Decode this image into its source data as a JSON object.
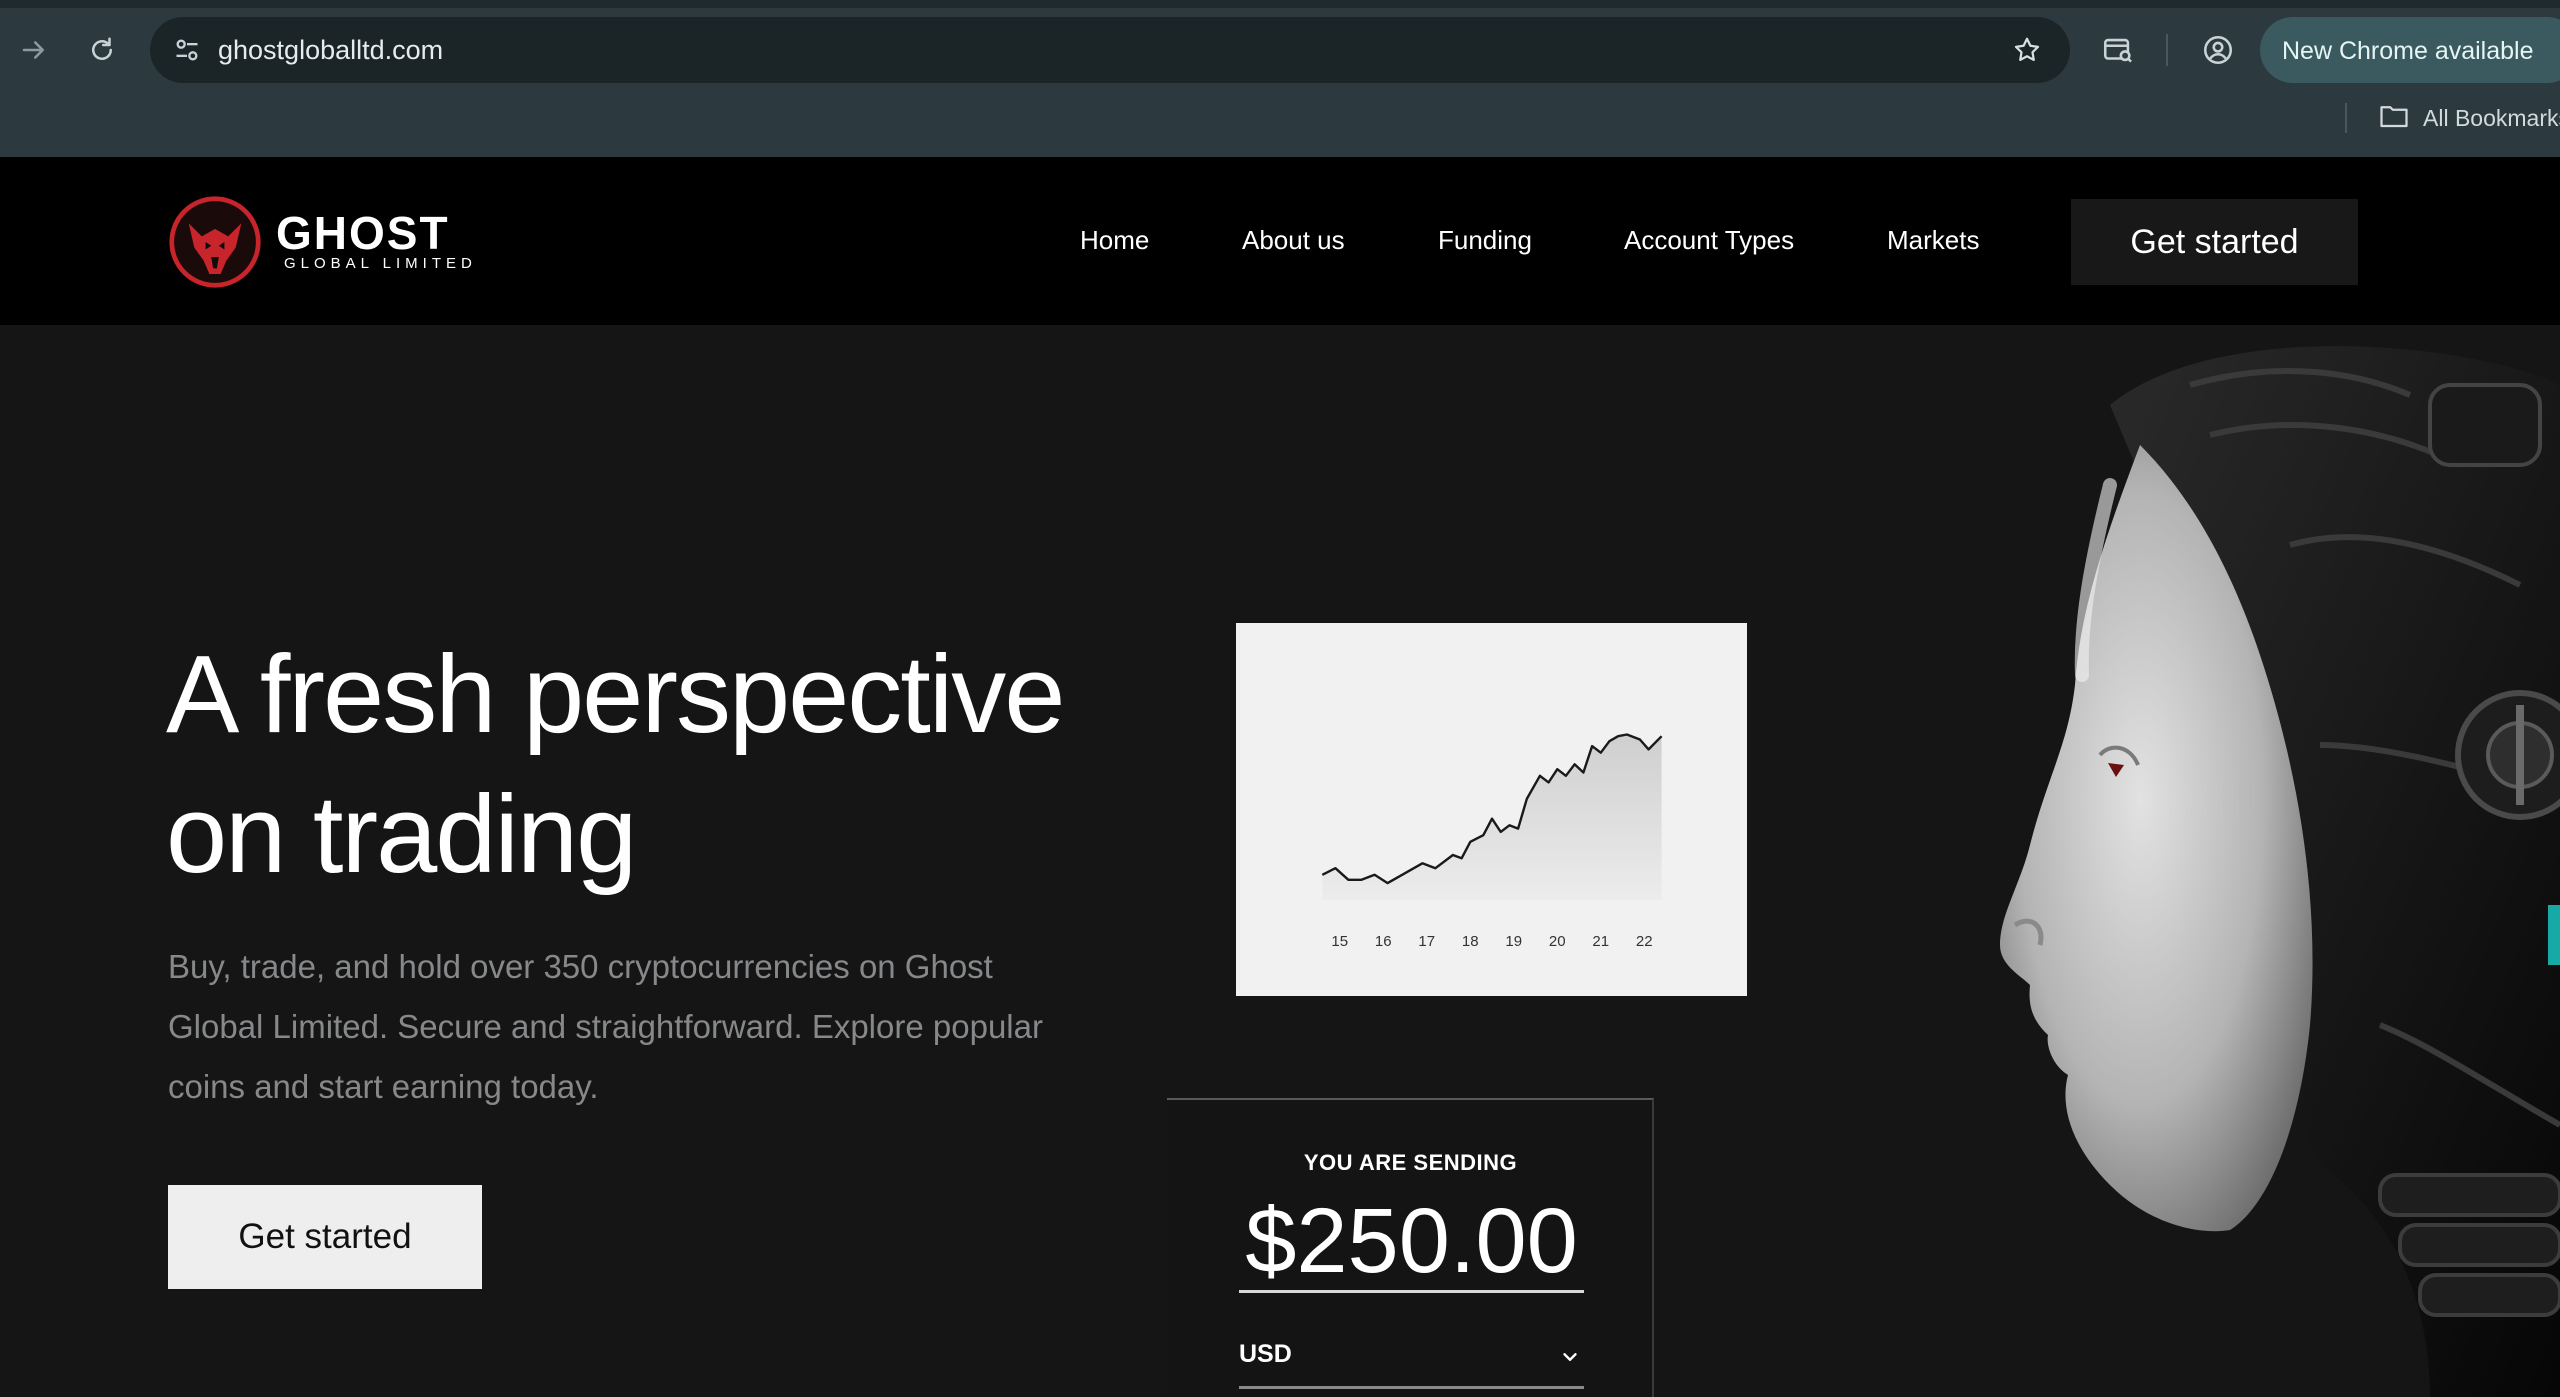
{
  "browser": {
    "url": "ghostgloballtd.com",
    "update_label": "New Chrome available",
    "bookmarks_label": "All Bookmarks",
    "icons": [
      "forward-icon",
      "reload-icon",
      "site-info-icon",
      "bookmark-star-icon",
      "tab-search-icon",
      "profile-icon",
      "folder-icon"
    ]
  },
  "site": {
    "brand": "GHOST",
    "brand_sub": "GLOBAL LIMITED",
    "nav": {
      "home": "Home",
      "about": "About us",
      "funding": "Funding",
      "account_types": "Account Types",
      "markets": "Markets"
    },
    "header_cta": "Get started"
  },
  "hero": {
    "headline_line1": "A fresh perspective",
    "headline_line2": "on trading",
    "subtext": "Buy, trade, and hold over 350 cryptocurrencies on Ghost Global Limited. Secure and straightforward. Explore popular coins and start earning today.",
    "cta": "Get started"
  },
  "send_widget": {
    "label": "YOU ARE SENDING",
    "amount": "$250.00",
    "currency": "USD"
  },
  "colors": {
    "page_bg": "#151515",
    "header_bg": "#000000",
    "chrome_bg": "#2c3a3f",
    "logo_red": "#c8242b",
    "cta_light": "#eeeeee"
  },
  "chart_data": {
    "type": "area",
    "x": [
      15,
      16,
      17,
      18,
      19,
      20,
      21,
      22
    ],
    "xticks": [
      "15",
      "16",
      "17",
      "18",
      "19",
      "20",
      "21",
      "22"
    ],
    "points": [
      [
        14.6,
        8
      ],
      [
        14.9,
        12
      ],
      [
        15.2,
        5
      ],
      [
        15.5,
        5
      ],
      [
        15.8,
        8
      ],
      [
        16.1,
        3
      ],
      [
        16.5,
        9
      ],
      [
        16.9,
        15
      ],
      [
        17.2,
        12
      ],
      [
        17.6,
        20
      ],
      [
        17.8,
        18
      ],
      [
        18.0,
        28
      ],
      [
        18.3,
        32
      ],
      [
        18.5,
        42
      ],
      [
        18.7,
        34
      ],
      [
        18.9,
        38
      ],
      [
        19.1,
        36
      ],
      [
        19.3,
        54
      ],
      [
        19.6,
        68
      ],
      [
        19.8,
        64
      ],
      [
        20.0,
        72
      ],
      [
        20.2,
        68
      ],
      [
        20.4,
        75
      ],
      [
        20.6,
        70
      ],
      [
        20.8,
        86
      ],
      [
        21.0,
        82
      ],
      [
        21.2,
        89
      ],
      [
        21.4,
        92
      ],
      [
        21.6,
        93
      ],
      [
        21.9,
        90
      ],
      [
        22.1,
        84
      ],
      [
        22.4,
        92
      ]
    ],
    "ylim": [
      0,
      100
    ]
  }
}
